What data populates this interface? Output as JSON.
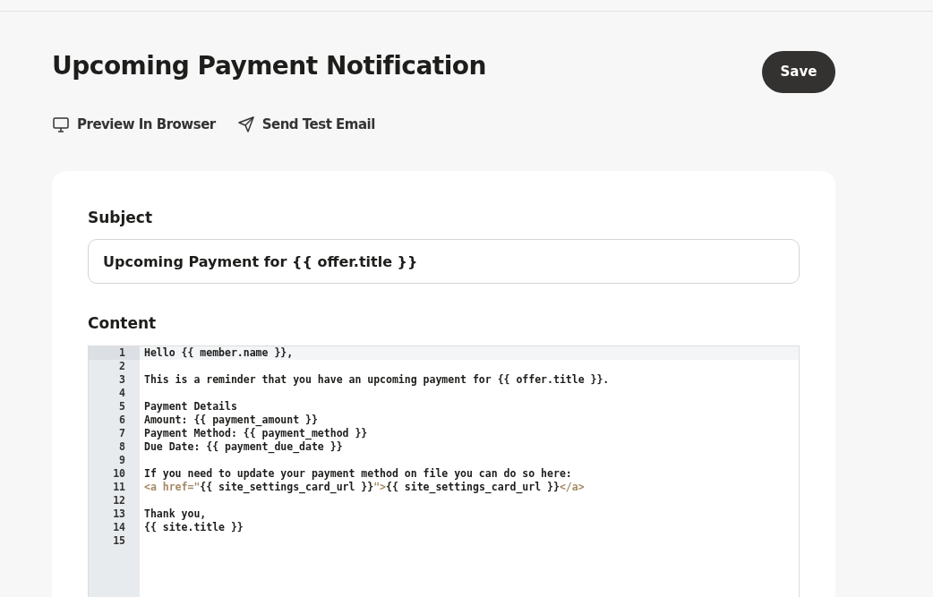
{
  "page": {
    "title": "Upcoming Payment Notification",
    "save_button": "Save"
  },
  "actions": [
    {
      "kind": "monitor",
      "label": "Preview In Browser"
    },
    {
      "kind": "send",
      "label": "Send Test Email"
    }
  ],
  "form": {
    "subject": {
      "label": "Subject",
      "value": "Upcoming Payment for {{ offer.title }}"
    },
    "content": {
      "label": "Content",
      "lines": [
        {
          "number": "1",
          "active": true,
          "segments": [
            {
              "kind": "text",
              "text": "Hello {{ member.name }},"
            }
          ]
        },
        {
          "number": "2",
          "active": false
        },
        {
          "number": "3",
          "active": false,
          "segments": [
            {
              "kind": "text",
              "text": "This is a reminder that you have an upcoming payment for {{ offer.title }}."
            }
          ]
        },
        {
          "number": "4",
          "active": false
        },
        {
          "number": "5",
          "active": false,
          "segments": [
            {
              "kind": "text",
              "text": "Payment Details"
            }
          ]
        },
        {
          "number": "6",
          "active": false,
          "segments": [
            {
              "kind": "text",
              "text": "Amount: {{ payment_amount }}"
            }
          ]
        },
        {
          "number": "7",
          "active": false,
          "segments": [
            {
              "kind": "text",
              "text": "Payment Method: {{ payment_method }}"
            }
          ]
        },
        {
          "number": "8",
          "active": false,
          "segments": [
            {
              "kind": "text",
              "text": "Due Date: {{ payment_due_date }}"
            }
          ]
        },
        {
          "number": "9",
          "active": false
        },
        {
          "number": "10",
          "active": false,
          "segments": [
            {
              "kind": "text",
              "text": "If you need to update your payment method on file you can do so here:"
            }
          ]
        },
        {
          "number": "11",
          "active": false,
          "segments": [
            {
              "kind": "tag",
              "text": "<a href=\""
            },
            {
              "kind": "text",
              "text": "{{ site_settings_card_url }}"
            },
            {
              "kind": "tag",
              "text": "\">"
            },
            {
              "kind": "text",
              "text": "{{ site_settings_card_url }}"
            },
            {
              "kind": "tag",
              "text": "</a>"
            }
          ]
        },
        {
          "number": "12",
          "active": false
        },
        {
          "number": "13",
          "active": false,
          "segments": [
            {
              "kind": "text",
              "text": "Thank you,"
            }
          ]
        },
        {
          "number": "14",
          "active": false,
          "segments": [
            {
              "kind": "text",
              "text": "{{ site.title }}"
            }
          ]
        },
        {
          "number": "15",
          "active": false
        }
      ]
    }
  }
}
